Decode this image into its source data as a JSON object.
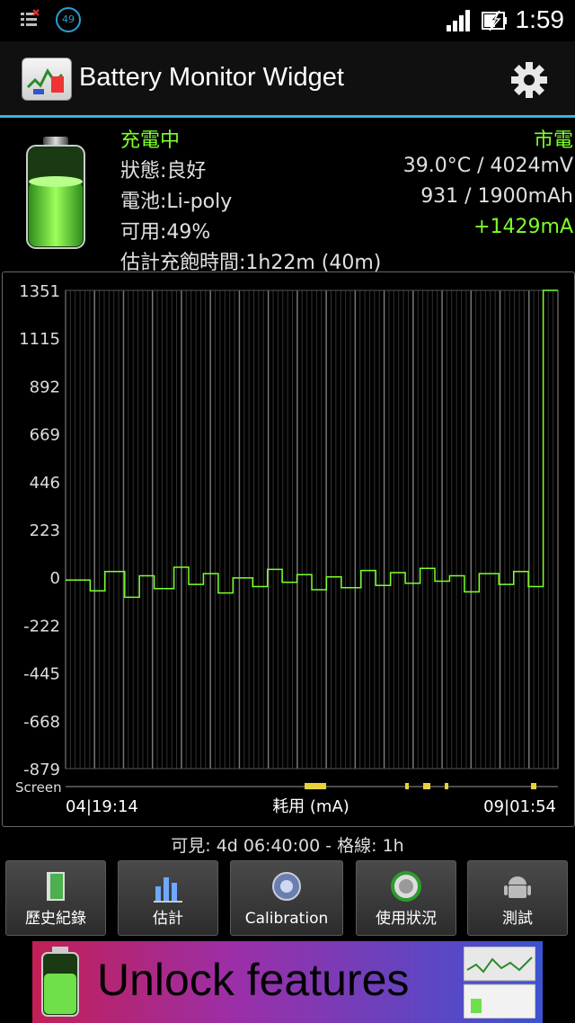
{
  "status_bar": {
    "time": "1:59",
    "notification_count": "49",
    "icons": [
      "list-icon",
      "sync-circle-icon",
      "signal-icon",
      "battery-charging-icon"
    ]
  },
  "action_bar": {
    "title": "Battery Monitor Widget",
    "icons": [
      "app-icon",
      "gear-icon"
    ]
  },
  "info": {
    "charging": "充電中",
    "source": "市電",
    "status": "狀態:良好",
    "temp_voltage": "39.0°C / 4024mV",
    "battery_type": "電池:Li-poly",
    "capacity": "931 / 1900mAh",
    "available": "可用:49%",
    "current": "+1429mA",
    "time_to_full": "估計充飽時間:1h22m (40m)"
  },
  "colors": {
    "accent": "#33b5e5",
    "green": "#7dff2b",
    "red": "#ff3b2b",
    "yellow": "#e6d23a"
  },
  "chart_data": {
    "type": "line",
    "ylim": [
      -879,
      1351
    ],
    "y_ticks": [
      "1351",
      "1115",
      "892",
      "669",
      "446",
      "223",
      "0",
      "-222",
      "-445",
      "-668",
      "-879"
    ],
    "x_start_label": "04|19:14",
    "x_end_label": "09|01:54",
    "xlabel": "耗用 (mA)",
    "screen_label": "Screen",
    "xlim": [
      0,
      100
    ],
    "series": [
      {
        "color": "#7dff2b",
        "x": [
          0,
          0.05,
          0.05,
          0.08,
          0.08,
          0.12,
          0.12,
          0.15,
          0.15,
          0.18,
          0.18,
          0.22,
          0.22,
          0.25,
          0.25,
          0.28,
          0.28,
          0.31,
          0.31,
          0.34,
          0.34,
          0.38,
          0.38,
          0.41,
          0.41,
          0.44,
          0.44,
          0.47,
          0.47,
          0.5,
          0.5,
          0.53,
          0.53,
          0.56,
          0.56,
          0.6,
          0.6,
          0.63,
          0.63,
          0.66,
          0.66,
          0.69,
          0.69,
          0.72,
          0.72,
          0.75,
          0.75,
          0.78,
          0.78,
          0.81,
          0.81,
          0.84,
          0.84,
          0.88,
          0.88,
          0.91,
          0.91,
          0.94,
          0.94,
          0.97,
          0.97,
          1.0
        ],
        "y": [
          0,
          0,
          -50,
          -50,
          40,
          40,
          -80,
          -80,
          20,
          20,
          -40,
          -40,
          60,
          60,
          -20,
          -20,
          30,
          30,
          -60,
          -60,
          10,
          10,
          -30,
          -30,
          50,
          50,
          -10,
          -10,
          25,
          25,
          -45,
          -45,
          15,
          15,
          -35,
          -35,
          45,
          45,
          -25,
          -25,
          35,
          35,
          -15,
          -15,
          55,
          55,
          -5,
          -5,
          20,
          20,
          -55,
          -55,
          30,
          30,
          -20,
          -20,
          40,
          40,
          -30,
          -30,
          1351,
          1351
        ]
      }
    ],
    "grid": true
  },
  "visible_label": "可見: 4d 06:40:00 - 格線: 1h",
  "buttons": [
    {
      "label": "歷史紀錄",
      "icon": "door-icon"
    },
    {
      "label": "估計",
      "icon": "bar-chart-icon"
    },
    {
      "label": "Calibration",
      "icon": "gauge-icon"
    },
    {
      "label": "使用狀況",
      "icon": "usage-icon"
    },
    {
      "label": "測試",
      "icon": "android-icon"
    }
  ],
  "banner": {
    "text": "Unlock features"
  }
}
